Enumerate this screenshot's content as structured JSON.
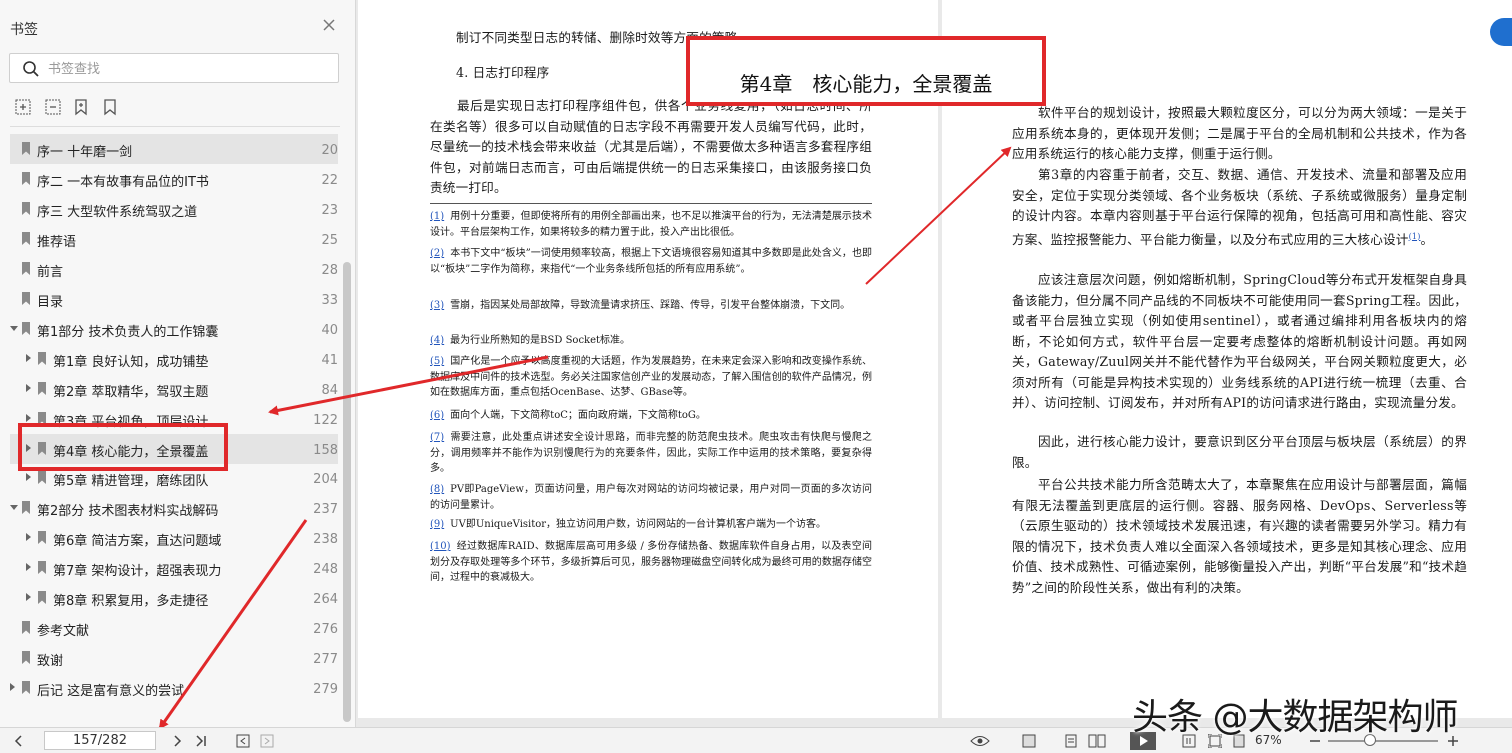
{
  "sidebar": {
    "title": "书签",
    "search_placeholder": "书签查找",
    "items": [
      {
        "label": "序一 十年磨一剑",
        "page": "20",
        "level": 0,
        "arrow": "none",
        "selected": true
      },
      {
        "label": "序二 一本有故事有品位的IT书",
        "page": "22",
        "level": 0,
        "arrow": "none",
        "selected": false
      },
      {
        "label": "序三 大型软件系统驾驭之道",
        "page": "23",
        "level": 0,
        "arrow": "none",
        "selected": false
      },
      {
        "label": "推荐语",
        "page": "25",
        "level": 0,
        "arrow": "none",
        "selected": false
      },
      {
        "label": "前言",
        "page": "28",
        "level": 0,
        "arrow": "none",
        "selected": false
      },
      {
        "label": "目录",
        "page": "33",
        "level": 0,
        "arrow": "none",
        "selected": false
      },
      {
        "label": "第1部分 技术负责人的工作锦囊",
        "page": "40",
        "level": 0,
        "arrow": "down",
        "selected": false
      },
      {
        "label": "第1章 良好认知，成功铺垫",
        "page": "41",
        "level": 1,
        "arrow": "right",
        "selected": false
      },
      {
        "label": "第2章 萃取精华，驾驭主题",
        "page": "84",
        "level": 1,
        "arrow": "right",
        "selected": false
      },
      {
        "label": "第3章 平台视角，顶层设计",
        "page": "122",
        "level": 1,
        "arrow": "right",
        "selected": false
      },
      {
        "label": "第4章 核心能力，全景覆盖",
        "page": "158",
        "level": 1,
        "arrow": "right",
        "selected": true
      },
      {
        "label": "第5章 精进管理，磨练团队",
        "page": "204",
        "level": 1,
        "arrow": "right",
        "selected": false
      },
      {
        "label": "第2部分 技术图表材料实战解码",
        "page": "237",
        "level": 0,
        "arrow": "down",
        "selected": false
      },
      {
        "label": "第6章 简洁方案，直达问题域",
        "page": "238",
        "level": 1,
        "arrow": "right",
        "selected": false
      },
      {
        "label": "第7章 架构设计，超强表现力",
        "page": "248",
        "level": 1,
        "arrow": "right",
        "selected": false
      },
      {
        "label": "第8章 积累复用，多走捷径",
        "page": "264",
        "level": 1,
        "arrow": "right",
        "selected": false
      },
      {
        "label": "参考文献",
        "page": "276",
        "level": 0,
        "arrow": "none",
        "selected": false
      },
      {
        "label": "致谢",
        "page": "277",
        "level": 0,
        "arrow": "none",
        "selected": false
      },
      {
        "label": "后记 这是富有意义的尝试",
        "page": "279",
        "level": 0,
        "arrow": "right",
        "selected": false
      }
    ]
  },
  "left_page": {
    "line1": "制订不同类型日志的转储、删除时效等方面的策略。",
    "heading": "4. 日志打印程序",
    "para": "最后是实现日志打印程序组件包，供各个业务线复用，（如日志时间、所在类名等）很多可以自动赋值的日志字段不再需要开发人员编写代码，此时，尽量统一的技术栈会带来收益（尤其是后端），不需要做太多种语言多套程序组件包，对前端日志而言，可由后端提供统一的日志采集接口，由该服务接口负责统一打印。",
    "footnotes": [
      {
        "num": "(1)",
        "text": "用例十分重要，但即使将所有的用例全部画出来，也不足以推演平台的行为，无法清楚展示技术设计。平台层架构工作，如果将较多的精力置于此，投入产出比很低。"
      },
      {
        "num": "(2)",
        "text": "本书下文中“板块”一词使用频率较高，根据上下文语境很容易知道其中多数即是此处含义，也即以“板块”二字作为简称，来指代“一个业务条线所包括的所有应用系统”。"
      },
      {
        "num": "(3)",
        "text": "雪崩，指因某处局部故障，导致流量请求挤压、踩踏、传导，引发平台整体崩溃，下文同。"
      },
      {
        "num": "(4)",
        "text": "最为行业所熟知的是BSD Socket标准。"
      },
      {
        "num": "(5)",
        "text": "国产化是一个应予以高度重视的大话题，作为发展趋势，在未来定会深入影响和改变操作系统、数据库及中间件的技术选型。务必关注国家信创产业的发展动态，了解入围信创的软件产品情况，例如在数据库方面，重点包括OcenBase、达梦、GBase等。"
      },
      {
        "num": "(6)",
        "text": "面向个人端，下文简称toC；面向政府端，下文简称toG。"
      },
      {
        "num": "(7)",
        "text": "需要注意，此处重点讲述安全设计思路，而非完整的防范爬虫技术。爬虫攻击有快爬与慢爬之分，调用频率并不能作为识别慢爬行为的充要条件，因此，实际工作中运用的技术策略，要复杂得多。"
      },
      {
        "num": "(8)",
        "text": "PV即PageView，页面访问量，用户每次对网站的访问均被记录，用户对同一页面的多次访问的访问量累计。"
      },
      {
        "num": "(9)",
        "text": "UV即UniqueVisitor，独立访问用户数，访问网站的一台计算机客户端为一个访客。"
      },
      {
        "num": "(10)",
        "text": "经过数据库RAID、数据库层高可用多级 / 多份存储热备、数据库软件自身占用，以及表空间划分及存取处理等多个环节，多级折算后可见，服务器物理磁盘空间转化成为最终可用的数据存储空间，过程中的衰减极大。"
      }
    ]
  },
  "right_page": {
    "chapter_title": "第4章　核心能力，全景覆盖",
    "para1": "软件平台的规划设计，按照最大颗粒度区分，可以分为两大领域：一是关于应用系统本身的，更体现开发侧；二是属于平台的全局机制和公共技术，作为各应用系统运行的核心能力支撑，侧重于运行侧。",
    "para2": "第3章的内容重于前者，交互、数据、通信、开发技术、流量和部署及应用安全，定位于实现分类领域、各个业务板块（系统、子系统或微服务）量身定制的设计内容。本章内容则基于平台运行保障的视角，包括高可用和高性能、容灾方案、监控报警能力、平台能力衡量，以及分布式应用的三大核心设计",
    "para2_note": "(1)",
    "para2_end": "。",
    "para3": "应该注意层次问题，例如熔断机制，SpringCloud等分布式开发框架自身具备该能力，但分属不同产品线的不同板块不可能使用同一套Spring工程。因此，或者平台层独立实现（例如使用sentinel），或者通过编排利用各板块内的熔断，不论如何方式，软件平台层一定要考虑整体的熔断机制设计问题。再如网关，Gateway/Zuul网关并不能代替作为平台级网关，平台网关颗粒度更大，必须对所有（可能是异构技术实现的）业务线系统的API进行统一梳理（去重、合并）、访问控制、订阅发布，并对所有API的访问请求进行路由，实现流量分发。",
    "para4": "因此，进行核心能力设计，要意识到区分平台顶层与板块层（系统层）的界限。",
    "para5": "平台公共技术能力所含范畴太大了，本章聚焦在应用设计与部署层面，篇幅有限无法覆盖到更底层的运行侧。容器、服务网格、DevOps、Serverless等（云原生驱动的）技术领域技术发展迅速，有兴趣的读者需要另外学习。精力有限的情况下，技术负责人难以全面深入各领域技术，更多是知其核心理念、应用价值、技术成熟性、可循迹案例，能够衡量投入产出，判断“平台发展”和“技术趋势”之间的阶段性关系，做出有利的决策。"
  },
  "toolbar": {
    "page_indicator": "157/282",
    "zoom": "67%",
    "zoom_level": 0.38
  },
  "watermark": "头条 @大数据架构师",
  "colors": {
    "annotation_red": "#e0282a",
    "link_blue": "#2255bb",
    "selection_gray": "#e4e4e4"
  }
}
